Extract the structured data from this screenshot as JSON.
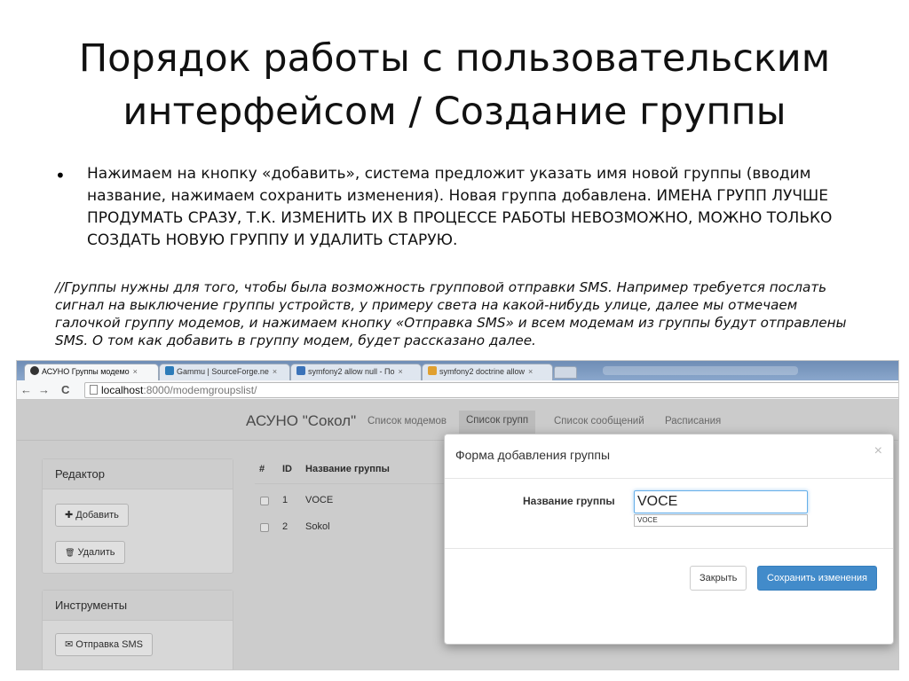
{
  "slide": {
    "title": "Порядок работы с пользовательским интерфейсом / Создание группы",
    "bullet_symbol": "•",
    "bullet": "Нажимаем на кнопку «добавить», система предложит указать имя новой группы (вводим название, нажимаем сохранить изменения). Новая группа добавлена. ИМЕНА ГРУПП ЛУЧШЕ ПРОДУМАТЬ СРАЗУ, Т.К. ИЗМЕНИТЬ ИХ В ПРОЦЕССЕ РАБОТЫ НЕВОЗМОЖНО, МОЖНО ТОЛЬКО СОЗДАТЬ НОВУЮ ГРУППУ И УДАЛИТЬ СТАРУЮ.",
    "note": "//Группы нужны для того, чтобы была возможность групповой отправки SMS. Например требуется послать сигнал на выключение группы устройств, у примеру света на какой-нибудь улице, далее мы отмечаем галочкой группу модемов, и нажимаем кнопку «Отправка SMS» и всем модемам из группы будут отправлены SMS. О том как добавить в группу модем, будет рассказано далее."
  },
  "browser": {
    "tabs": [
      {
        "label": "АСУНО Группы модемо",
        "close": "×",
        "icon_color": "#333333"
      },
      {
        "label": "Gammu | SourceForge.ne",
        "close": "×",
        "icon_color": "#2b7bb9"
      },
      {
        "label": "symfony2 allow null - По",
        "close": "×",
        "icon_color": "#3b73b9"
      },
      {
        "label": "symfony2 doctrine allow",
        "close": "×",
        "icon_color": "#e0a030"
      }
    ],
    "nav": {
      "back": "←",
      "forward": "→",
      "reload": "C"
    },
    "url_host": "localhost",
    "url_path": ":8000/modemgroupslist/"
  },
  "app": {
    "brand": "АСУНО \"Сокол\"",
    "nav_links": [
      "Список модемов",
      "Список групп",
      "Список сообщений",
      "Расписания"
    ],
    "active_nav": "Список групп",
    "editor_panel": {
      "title": "Редактор",
      "add_icon": "✚",
      "add_label": "Добавить",
      "delete_icon": "🗑",
      "delete_label": "Удалить"
    },
    "tools_panel": {
      "title": "Инструменты",
      "sms_icon": "✉",
      "sms_label": "Отправка SMS"
    },
    "table": {
      "columns": [
        "#",
        "ID",
        "Название группы"
      ],
      "rows": [
        {
          "id": "1",
          "name": "VOCE"
        },
        {
          "id": "2",
          "name": "Sokol"
        }
      ]
    }
  },
  "modal": {
    "title": "Форма добавления группы",
    "close_glyph": "×",
    "field_label": "Название группы",
    "field_value": "VOCE",
    "autocomplete_suggestion": "VOCE",
    "close_button": "Закрыть",
    "save_button": "Сохранить изменения"
  },
  "colors": {
    "primary": "#428bca",
    "tabstrip": "#7b98bf"
  }
}
